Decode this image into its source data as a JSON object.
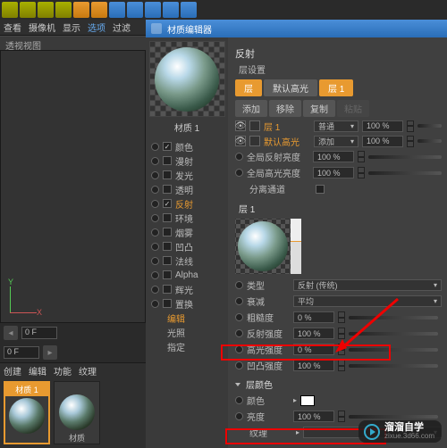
{
  "toolbar": {
    "icons": [
      "select",
      "move",
      "rotate",
      "scale"
    ]
  },
  "menu": {
    "view": "查看",
    "camera": "摄像机",
    "display": "显示",
    "options": "选项",
    "filter": "过滤"
  },
  "viewport_label": "透视视图",
  "axis": {
    "x": "X",
    "y": "Y"
  },
  "timeline": {
    "frame": "0 F",
    "end": "0 F"
  },
  "mat_browser": {
    "tabs": [
      "创建",
      "编辑",
      "功能",
      "纹理"
    ],
    "m1": "材质 1",
    "m2": "材质"
  },
  "editor": {
    "title": "材质编辑器",
    "mat_name": "材质 1"
  },
  "channels": [
    {
      "k": "color",
      "label": "颜色",
      "on": true
    },
    {
      "k": "diffuse",
      "label": "漫射",
      "on": false
    },
    {
      "k": "lum",
      "label": "发光",
      "on": false
    },
    {
      "k": "trans",
      "label": "透明",
      "on": false
    },
    {
      "k": "refl",
      "label": "反射",
      "on": true,
      "active": true
    },
    {
      "k": "env",
      "label": "环境",
      "on": false
    },
    {
      "k": "fog",
      "label": "烟雾",
      "on": false
    },
    {
      "k": "bump",
      "label": "凹凸",
      "on": false
    },
    {
      "k": "normal",
      "label": "法线",
      "on": false
    },
    {
      "k": "alpha",
      "label": "Alpha",
      "on": false
    },
    {
      "k": "glow",
      "label": "辉光",
      "on": false
    },
    {
      "k": "disp",
      "label": "置换",
      "on": false
    },
    {
      "k": "editor_ch",
      "label": "编辑",
      "special": true
    },
    {
      "k": "illum",
      "label": "光照",
      "special": true
    },
    {
      "k": "assign",
      "label": "指定",
      "special": true
    }
  ],
  "reflection": {
    "heading": "反射",
    "layer_settings": "层设置",
    "tabs": {
      "layer": "层",
      "default_hl": "默认高光",
      "layer1": "层 1"
    },
    "btns": {
      "add": "添加",
      "remove": "移除",
      "copy": "复制",
      "paste": "粘贴"
    },
    "layers": {
      "l1": {
        "name": "层 1",
        "mode": "普通",
        "opacity": "100 %"
      },
      "dh": {
        "name": "默认高光",
        "mode": "添加",
        "opacity": "100 %"
      }
    },
    "globals": {
      "refl_bright_lbl": "全局反射亮度",
      "refl_bright": "100 %",
      "spec_bright_lbl": "全局高光亮度",
      "spec_bright": "100 %",
      "sep_lbl": "分离通道"
    },
    "layer1": {
      "heading": "层 1",
      "type_lbl": "类型",
      "type": "反射 (传统)",
      "atten_lbl": "衰减",
      "atten": "平均",
      "rough_lbl": "粗糙度",
      "rough": "0 %",
      "refl_str_lbl": "反射强度",
      "refl_str": "100 %",
      "spec_str_lbl": "高光强度",
      "spec_str": "0 %",
      "bump_str_lbl": "凹凸强度",
      "bump_str": "100 %"
    },
    "layer_color": {
      "heading": "层颜色",
      "color_lbl": "颜色",
      "bright_lbl": "亮度",
      "bright": "100 %",
      "tex_lbl": "纹理"
    }
  },
  "watermark": {
    "brand": "溜溜自学",
    "url": "zixue.3d66.com"
  }
}
